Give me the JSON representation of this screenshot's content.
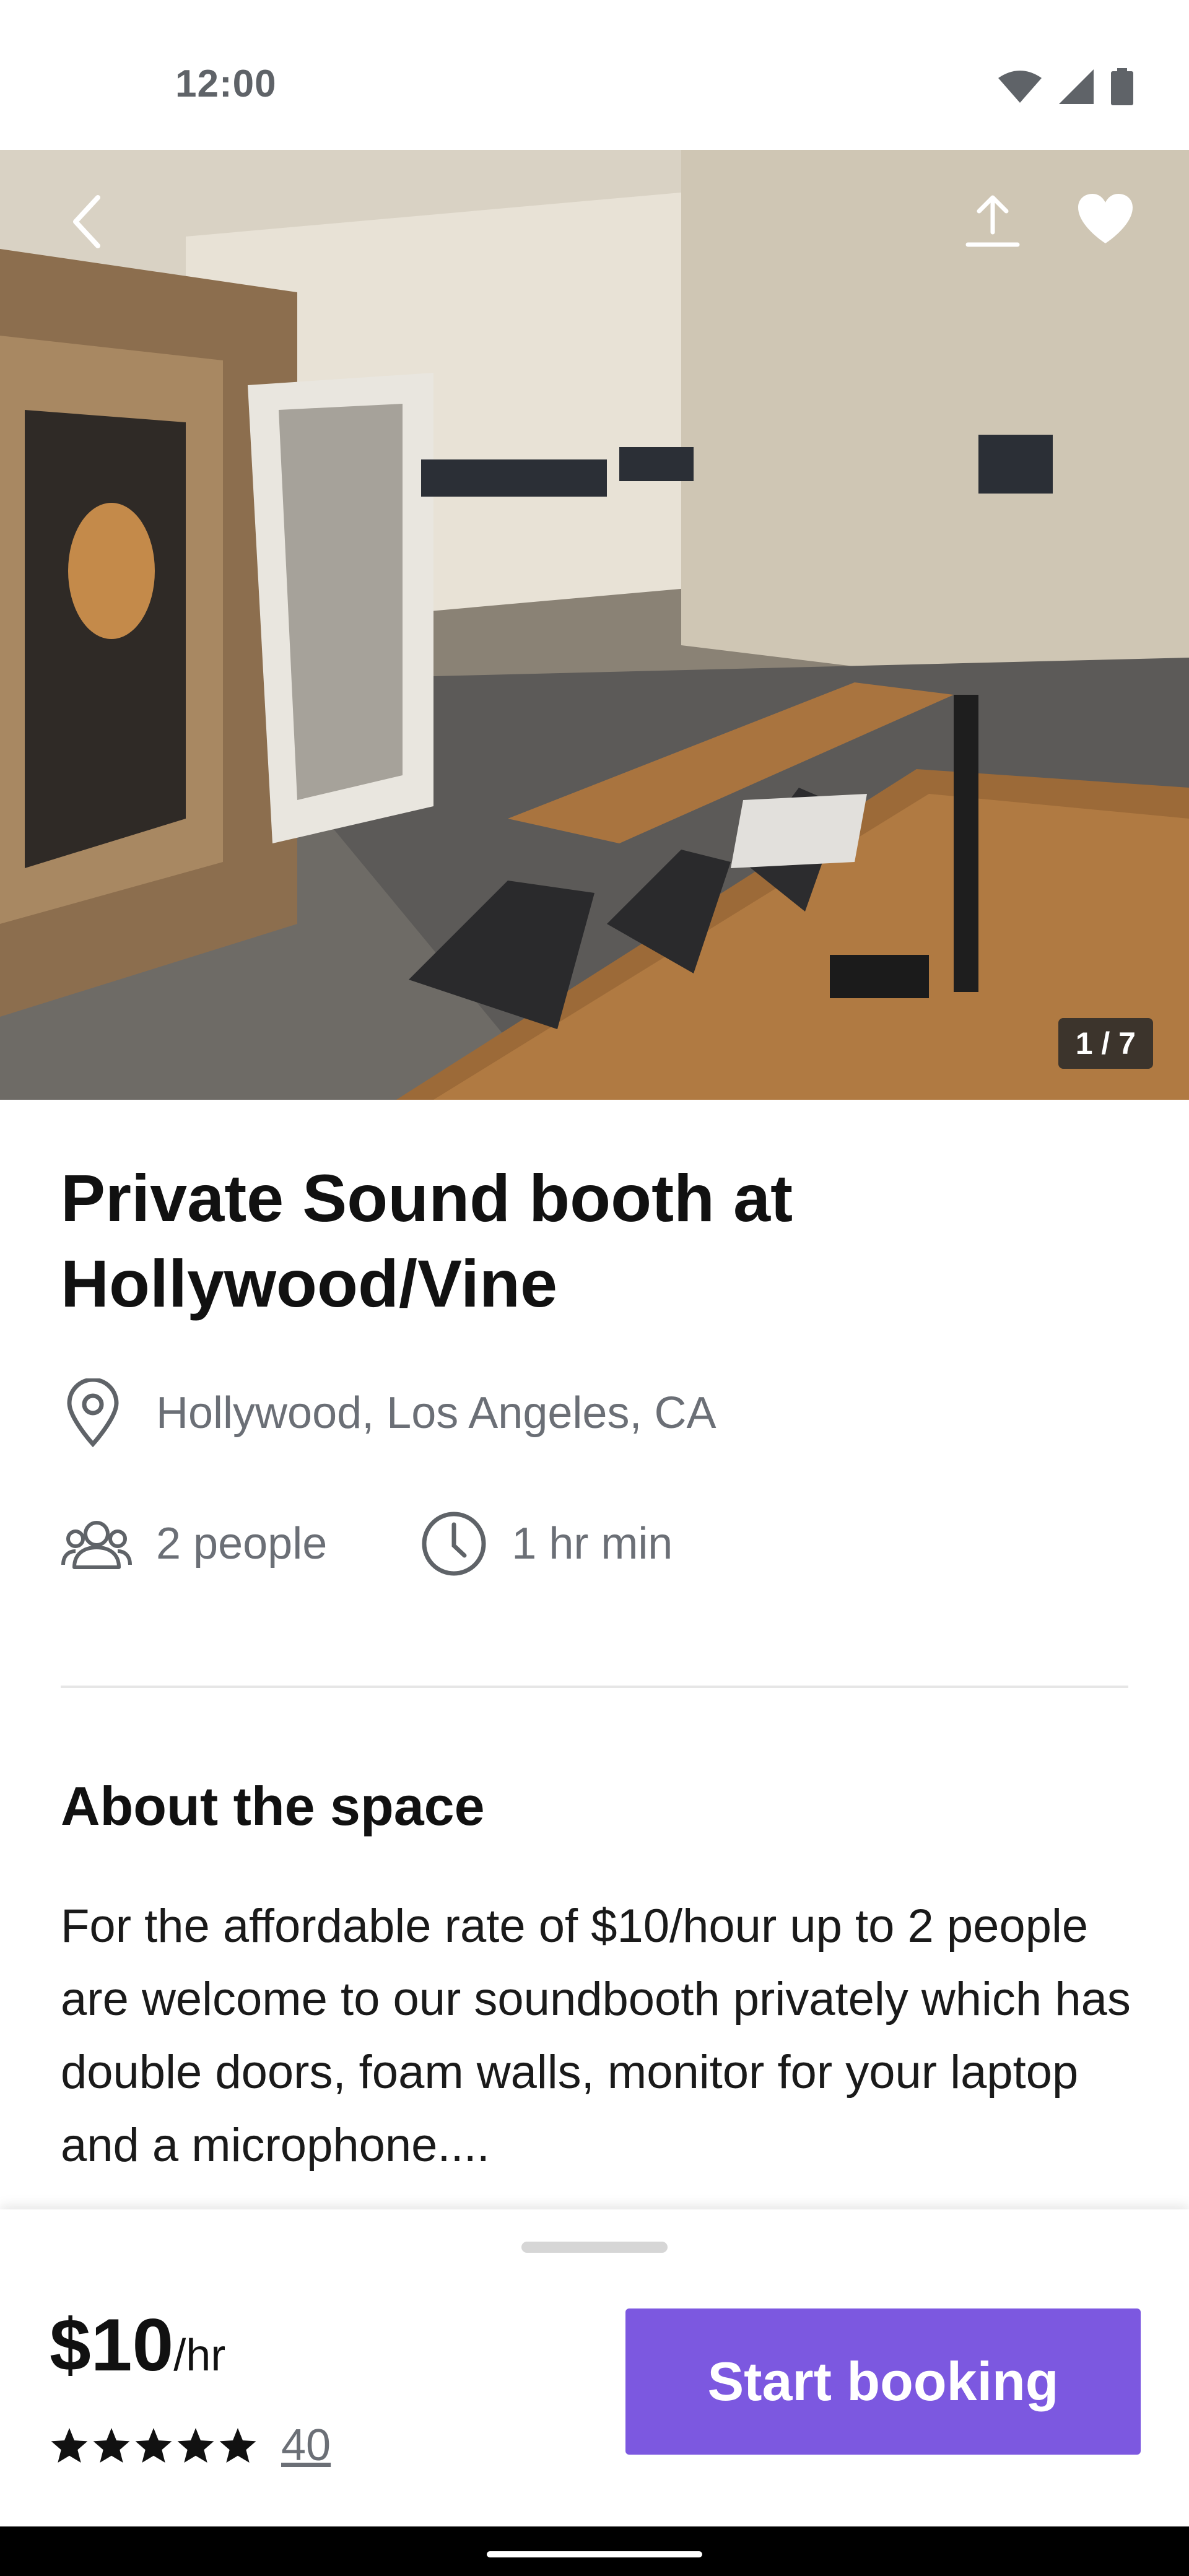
{
  "status_bar": {
    "time": "12:00",
    "icons": [
      "wifi-icon",
      "signal-icon",
      "battery-icon"
    ]
  },
  "hero": {
    "photo_counter": "1 / 7",
    "icons": {
      "back": "chevron-left-icon",
      "share": "share-upload-icon",
      "favorite": "heart-icon"
    }
  },
  "listing": {
    "title": "Private Sound booth at Hollywood/Vine",
    "location": "Hollywood, Los Angeles, CA",
    "capacity": "2 people",
    "minimum": "1 hr min"
  },
  "about": {
    "title": "About the space",
    "text": "For the affordable rate of $10/hour up to 2 people are welcome to our soundbooth privately which has double doors, foam walls, monitor for your laptop and a microphone...."
  },
  "booking": {
    "price": "$10",
    "unit": "/hr",
    "rating": 5,
    "review_count": "40",
    "cta_label": "Start booking"
  },
  "colors": {
    "accent": "#7c58e0",
    "text": "#1a1a1a",
    "muted": "#6b6f76"
  }
}
